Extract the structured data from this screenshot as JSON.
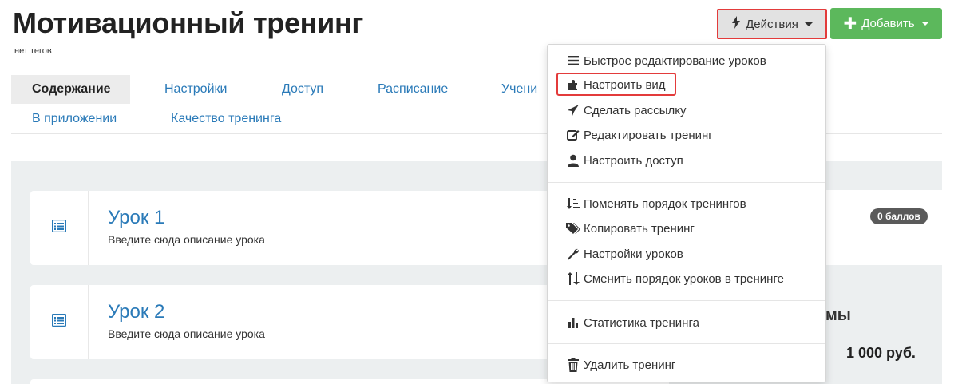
{
  "header": {
    "title": "Мотивационный тренинг",
    "tags": "нет тегов",
    "actions_label": "Действия",
    "add_label": "Добавить"
  },
  "tabs": [
    {
      "label": "Содержание",
      "active": true
    },
    {
      "label": "Настройки"
    },
    {
      "label": "Доступ"
    },
    {
      "label": "Расписание"
    },
    {
      "label": "Учени"
    },
    {
      "label": "В приложении"
    },
    {
      "label": "Качество тренинга"
    }
  ],
  "lessons": [
    {
      "title": "Урок 1",
      "description": "Введите сюда описание урока"
    },
    {
      "title": "Урок 2",
      "description": "Введите сюда описание урока"
    }
  ],
  "right": {
    "badge": "0 баллов",
    "label": "мы",
    "price": "1 000 руб."
  },
  "dropdown": {
    "items": [
      {
        "label": "Быстрое редактирование уроков",
        "icon": "list-icon"
      },
      {
        "label": "Настроить вид",
        "icon": "puzzle-icon",
        "highlighted": true
      },
      {
        "label": "Сделать рассылку",
        "icon": "send-icon"
      },
      {
        "label": "Редактировать тренинг",
        "icon": "edit-icon"
      },
      {
        "label": "Настроить доступ",
        "icon": "user-icon"
      },
      {
        "label": "Поменять порядок тренингов",
        "icon": "sort-icon"
      },
      {
        "label": "Копировать тренинг",
        "icon": "tags-icon"
      },
      {
        "label": "Настройки уроков",
        "icon": "wrench-icon"
      },
      {
        "label": "Сменить порядок уроков в тренинге",
        "icon": "updown-icon"
      },
      {
        "label": "Статистика тренинга",
        "icon": "bar-chart-icon"
      },
      {
        "label": "Удалить тренинг",
        "icon": "trash-icon"
      }
    ]
  },
  "colors": {
    "link": "#2a7ab8",
    "add_button": "#5cb85c",
    "highlight": "#e33b3b",
    "badge": "#5a5a5a"
  }
}
